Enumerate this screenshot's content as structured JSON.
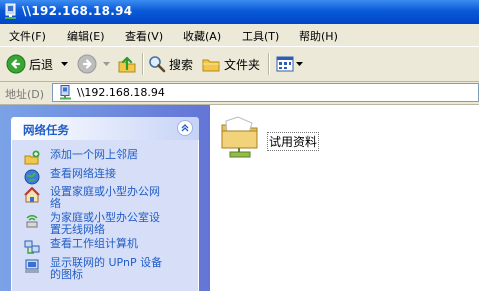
{
  "window": {
    "title": "\\\\192.168.18.94"
  },
  "menu": [
    "文件(F)",
    "编辑(E)",
    "查看(V)",
    "收藏(A)",
    "工具(T)",
    "帮助(H)"
  ],
  "toolbar": {
    "back_label": "后退",
    "search_label": "搜索",
    "folders_label": "文件夹"
  },
  "address": {
    "label": "地址(D)",
    "value": "\\\\192.168.18.94"
  },
  "task_panel": {
    "title": "网络任务",
    "items": [
      {
        "label": "添加一个网上邻居",
        "icon": "add-network-place-icon"
      },
      {
        "label": "查看网络连接",
        "icon": "network-connections-icon"
      },
      {
        "label": "设置家庭或小型办公网\n络",
        "icon": "home-network-setup-icon"
      },
      {
        "label": "为家庭或小型办公室设\n置无线网络",
        "icon": "wireless-network-icon"
      },
      {
        "label": "查看工作组计算机",
        "icon": "workgroup-computers-icon"
      },
      {
        "label": "显示联网的 UPnP 设备\n的图标",
        "icon": "upnp-devices-icon"
      }
    ]
  },
  "files": [
    {
      "name": "试用资料",
      "icon": "shared-folder-icon"
    }
  ],
  "colors": {
    "title_bar": "#0a5ad8",
    "task_link": "#215dc6",
    "left_pane": "#7ba2e7"
  }
}
